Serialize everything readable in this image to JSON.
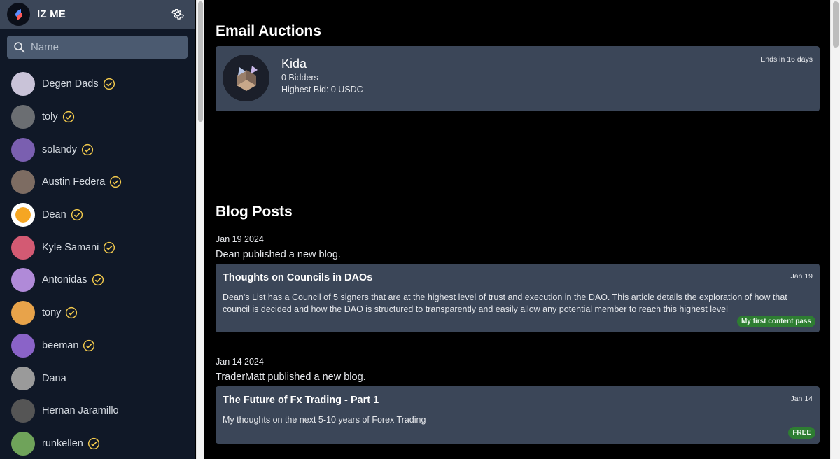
{
  "app": {
    "title": "IZ ME"
  },
  "search": {
    "placeholder": "Name"
  },
  "users": [
    {
      "name": "Degen Dads",
      "verified": true,
      "color": "#c9c3d8"
    },
    {
      "name": "toly",
      "verified": true,
      "color": "#6b6e72"
    },
    {
      "name": "solandy",
      "verified": true,
      "color": "#7a5fb0"
    },
    {
      "name": "Austin Federa",
      "verified": true,
      "color": "#7d6c62"
    },
    {
      "name": "Dean",
      "verified": true,
      "color": "#f5a623"
    },
    {
      "name": "Kyle Samani",
      "verified": true,
      "color": "#d35a73"
    },
    {
      "name": "Antonidas",
      "verified": true,
      "color": "#b08ad8"
    },
    {
      "name": "tony",
      "verified": true,
      "color": "#e8a34a"
    },
    {
      "name": "beeman",
      "verified": true,
      "color": "#8a63c8"
    },
    {
      "name": "Dana",
      "verified": false,
      "color": "#9a9a9a"
    },
    {
      "name": "Hernan Jaramillo",
      "verified": false,
      "color": "#555555"
    },
    {
      "name": "runkellen",
      "verified": true,
      "color": "#6fa35a"
    }
  ],
  "auctions": {
    "section_title": "Email Auctions",
    "item": {
      "name": "Kida",
      "bidders": "0 Bidders",
      "highest_bid": "Highest Bid: 0 USDC",
      "ends": "Ends in 16 days"
    }
  },
  "blog": {
    "section_title": "Blog Posts",
    "posts": [
      {
        "date": "Jan 19 2024",
        "published": "Dean published a new blog.",
        "title": "Thoughts on Councils in DAOs",
        "short_date": "Jan 19",
        "body": "Dean's List has a Council of 5 signers that are at the highest level of trust and execution in the DAO. This article details the exploration of how that council is decided and how the DAO is structured to transparently and easily allow any potential member to reach this highest level",
        "badge": "My first content pass"
      },
      {
        "date": "Jan 14 2024",
        "published": "TraderMatt published a new blog.",
        "title": "The Future of Fx Trading - Part 1",
        "short_date": "Jan 14",
        "body": "My thoughts on the next 5-10 years of Forex Trading",
        "badge": "FREE"
      }
    ]
  },
  "colors": {
    "sidebar_bg": "#101827",
    "card_bg": "#3b4658",
    "badge_green": "#2e7d32",
    "verified_yellow": "#f2c94c"
  }
}
